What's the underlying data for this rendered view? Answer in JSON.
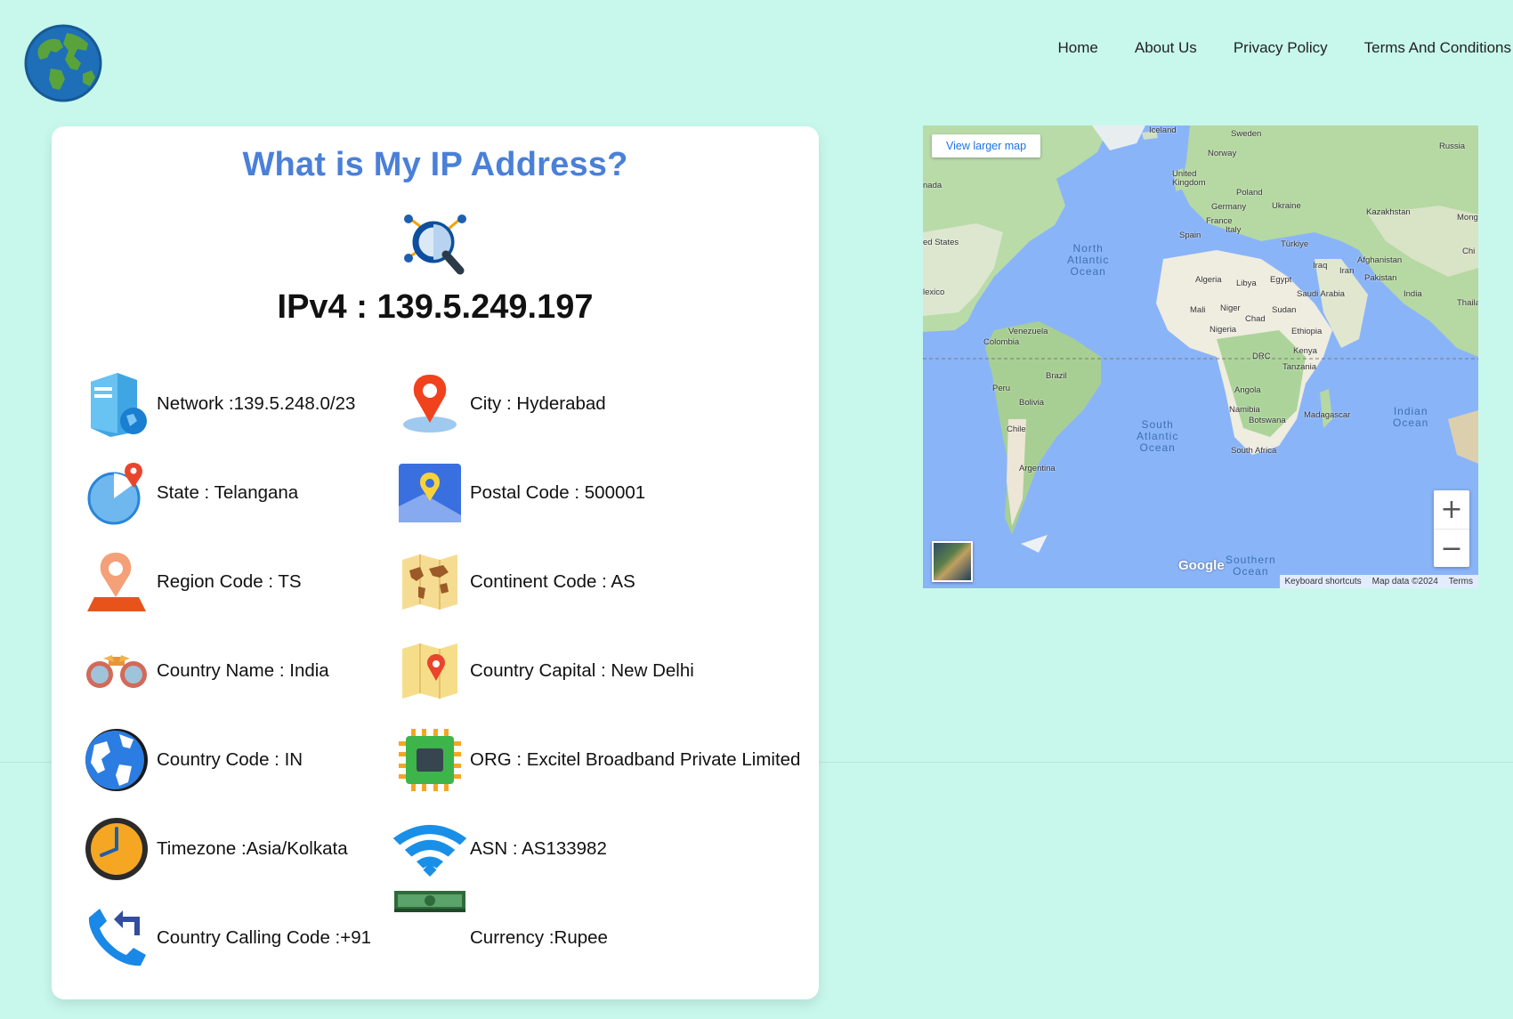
{
  "nav": {
    "items": [
      "Home",
      "About Us",
      "Privacy Policy",
      "Terms And Conditions"
    ]
  },
  "card": {
    "title": "What is My IP Address?",
    "ip_line": "IPv4 : 139.5.249.197",
    "items_left": [
      {
        "icon": "server-globe-icon",
        "text": "Network :139.5.248.0/23"
      },
      {
        "icon": "map-pie-pin-icon",
        "text": "State : Telangana"
      },
      {
        "icon": "location-pin-icon",
        "text": "Region Code : TS"
      },
      {
        "icon": "binoculars-icon",
        "text": "Country Name : India"
      },
      {
        "icon": "globe-icon",
        "text": "Country Code : IN"
      },
      {
        "icon": "clock-icon",
        "text": "Timezone :Asia/Kolkata"
      },
      {
        "icon": "phone-call-icon",
        "text": "Country Calling Code :+91"
      }
    ],
    "items_right": [
      {
        "icon": "map-marker-icon",
        "text": "City : Hyderabad"
      },
      {
        "icon": "map-app-icon",
        "text": "Postal Code : 500001"
      },
      {
        "icon": "world-map-icon",
        "text": "Continent Code : AS"
      },
      {
        "icon": "folded-map-icon",
        "text": "Country Capital : New Delhi"
      },
      {
        "icon": "chip-icon",
        "text": "ORG : Excitel Broadband Private Limited"
      },
      {
        "icon": "wifi-icon",
        "text": "ASN : AS133982"
      },
      {
        "icon": "money-stack-icon",
        "text": "Currency :Rupee"
      }
    ]
  },
  "map": {
    "view_larger": "View larger map",
    "zoom_in": "+",
    "zoom_out": "−",
    "google": "Google",
    "attribution": [
      "Keyboard shortcuts",
      "Map data ©2024",
      "Terms"
    ],
    "labels": {
      "iceland": "Iceland",
      "sweden": "Sweden",
      "russia": "Russia",
      "norway": "Norway",
      "canada": "nada",
      "uk": "United\nKingdom",
      "poland": "Poland",
      "germany": "Germany",
      "ukraine": "Ukraine",
      "kazakhstan": "Kazakhstan",
      "mongolia": "Mong",
      "france": "France",
      "italy": "Italy",
      "spain": "Spain",
      "turkiye": "Türkiye",
      "us": "ed States",
      "china": "Chi",
      "afghanistan": "Afghanistan",
      "iraq": "Iraq",
      "iran": "Iran",
      "pakistan": "Pakistan",
      "algeria": "Algeria",
      "libya": "Libya",
      "egypt": "Egypt",
      "saudi": "Saudi Arabia",
      "india": "India",
      "thailand": "Thailan",
      "mexico": "lexico",
      "mali": "Mali",
      "niger": "Niger",
      "sudan": "Sudan",
      "chad": "Chad",
      "nigeria": "Nigeria",
      "ethiopia": "Ethiopia",
      "venezuela": "Venezuela",
      "colombia": "Colombia",
      "kenya": "Kenya",
      "drc": "DRC",
      "brazil": "Brazil",
      "peru": "Peru",
      "tanzania": "Tanzania",
      "bolivia": "Bolivia",
      "angola": "Angola",
      "namibia": "Namibia",
      "madagascar": "Madagascar",
      "botswana": "Botswana",
      "chile": "Chile",
      "south_africa": "South Africa",
      "argentina": "Argentina"
    },
    "oceans": {
      "north_atlantic": "North\nAtlantic\nOcean",
      "south_atlantic": "South\nAtlantic\nOcean",
      "indian": "Indian\nOcean",
      "southern": "Southern\nOcean"
    }
  }
}
